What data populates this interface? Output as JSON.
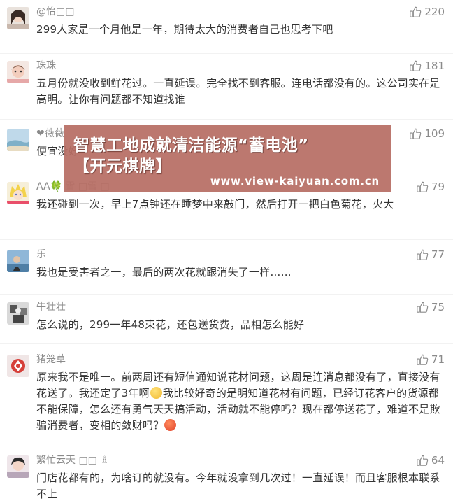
{
  "comments": [
    {
      "username": "@怡□□",
      "likes": "220",
      "text": "299人家是一个月他是一年，期待太大的消费者自己也思考下吧"
    },
    {
      "username": "珠珠",
      "likes": "181",
      "text": "五月份就没收到鲜花过。一直延误。完全找不到客服。连电话都没有的。这公司实在是高明。让你有问题都不知道找谁"
    },
    {
      "username": "❤薇薇",
      "likes": "109",
      "text": "便宜没好"
    },
    {
      "username": "AA🍀 雪 □雪 □",
      "likes": "79",
      "text": "我还碰到一次，早上7点钟还在睡梦中来敲门，然后打开一把白色菊花，火大"
    },
    {
      "username": "乐",
      "likes": "77",
      "text": "我也是受害者之一，最后的两次花就跟消失了一样……"
    },
    {
      "username": "牛壮壮",
      "likes": "75",
      "text": "怎么说的，299一年48束花，还包送货费，品相怎么能好"
    },
    {
      "username": "猪笼草",
      "likes": "71",
      "text_before": "原来我不是唯一。前两周还有短信通知说花材问题，这周是连消息都没有了，直接没有花送了。我还定了3年啊",
      "text_middle": "我比较好奇的是明知道花材有问题，已经订花客户的货源都不能保障，怎么还有勇气天天搞活动，活动就不能停吗？现在都停送花了，难道不是欺骗消费者，变相的敛财吗？",
      "text_after": ""
    },
    {
      "username": "繁忙云天 □□ ♗",
      "likes": "64",
      "text": "门店花都有的，为啥订的就没有。今年就没拿到几次过！一直延误！而且客服根本联系不上"
    }
  ],
  "watermark": {
    "title_line1": "智慧工地成就清洁能源“蓄电池”",
    "title_line2": "【开元棋牌】",
    "url": "www.view-kaiyuan.com.cn"
  },
  "icons": {
    "like": "thumbs-up-icon"
  },
  "colors": {
    "meta_gray": "#8a8a8a",
    "text": "#333333",
    "watermark_bg": "#b76e64"
  }
}
